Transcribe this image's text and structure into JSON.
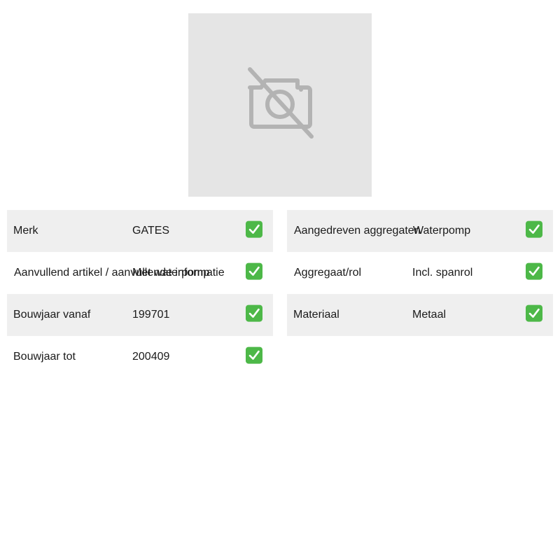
{
  "product": {
    "image_placeholder_icon": "camera-off-icon"
  },
  "specs": {
    "left": [
      {
        "label": "Merk",
        "value": "GATES",
        "check_icon": "check-mark-icon"
      },
      {
        "label": "Aanvullend artikel / aanvullende informatie",
        "value": "Met waterpomp",
        "check_icon": "check-mark-icon"
      },
      {
        "label": "Bouwjaar vanaf",
        "value": "199701",
        "check_icon": "check-mark-icon"
      },
      {
        "label": "Bouwjaar tot",
        "value": "200409",
        "check_icon": "check-mark-icon"
      }
    ],
    "right": [
      {
        "label": "Aangedreven aggregaten",
        "value": "Waterpomp",
        "check_icon": "check-mark-icon"
      },
      {
        "label": "Aggregaat/rol",
        "value": "Incl. spanrol",
        "check_icon": "check-mark-icon"
      },
      {
        "label": "Materiaal",
        "value": "Metaal",
        "check_icon": "check-mark-icon"
      }
    ]
  },
  "colors": {
    "check_green": "#4db848",
    "row_shade": "#efefef",
    "placeholder_bg": "#e5e5e5",
    "placeholder_icon": "#b3b3b3"
  }
}
